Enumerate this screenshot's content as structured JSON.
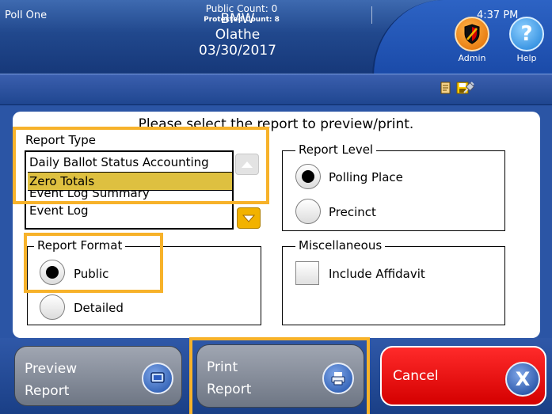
{
  "header": {
    "line1": "BMW",
    "line2": "Olathe",
    "date": "03/30/2017",
    "admin_label": "Admin",
    "help_label": "Help",
    "help_icon_glyph": "?",
    "admin_icon": "shield-icon",
    "help_icon": "question-icon"
  },
  "status": {
    "poll_name": "Poll One",
    "public_count": "Public Count: 0",
    "protected_count": "Protected Count: 8",
    "time": "4:37 PM",
    "icons": [
      "document-icon",
      "save-icon",
      "plug-icon"
    ]
  },
  "instruction": "Please select the report to preview/print.",
  "report_type": {
    "label": "Report Type",
    "items": [
      "Daily Ballot Status Accounting",
      "Zero Totals",
      "Event Log Summary",
      "Event Log"
    ],
    "selected": "Zero Totals"
  },
  "report_level": {
    "title": "Report Level",
    "options": [
      "Polling Place",
      "Precinct"
    ],
    "selected": "Polling Place"
  },
  "report_format": {
    "title": "Report Format",
    "options": [
      "Public",
      "Detailed"
    ],
    "selected": "Public"
  },
  "misc": {
    "title": "Miscellaneous",
    "include_affidavit_label": "Include Affidavit",
    "include_affidavit_checked": false
  },
  "buttons": {
    "preview_line1": "Preview",
    "preview_line2": "Report",
    "print_line1": "Print",
    "print_line2": "Report",
    "cancel": "Cancel",
    "cancel_icon_glyph": "X"
  },
  "colors": {
    "header_blue": "#21488d",
    "selection_yellow": "#dec040",
    "highlight_orange": "#f7b22a",
    "cancel_red": "#e00000"
  }
}
